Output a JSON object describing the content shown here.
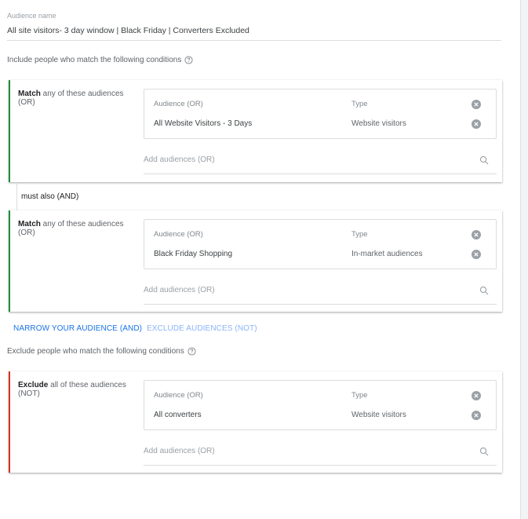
{
  "audience_name": {
    "label": "Audience name",
    "value": "All site visitors- 3 day window | Black Friday | Converters Excluded"
  },
  "include_heading": "Include people who match the following conditions",
  "exclude_heading": "Exclude people who match the following conditions",
  "connector_label": "must also (AND)",
  "groups": [
    {
      "match_word": "Match",
      "match_rest": " any of these audiences",
      "match_suffix": "(OR)",
      "audience_header": "Audience (OR)",
      "type_header": "Type",
      "audience_value": "All Website Visitors - 3 Days",
      "type_value": "Website visitors",
      "add_placeholder": "Add audiences (OR)"
    },
    {
      "match_word": "Match",
      "match_rest": " any of these audiences",
      "match_suffix": "(OR)",
      "audience_header": "Audience (OR)",
      "type_header": "Type",
      "audience_value": "Black Friday Shopping",
      "type_value": "In-market audiences",
      "add_placeholder": "Add audiences (OR)"
    }
  ],
  "exclude_group": {
    "match_word": "Exclude",
    "match_rest": " all of these audiences",
    "match_suffix": "(NOT)",
    "audience_header": "Audience (OR)",
    "type_header": "Type",
    "audience_value": "All converters",
    "type_value": "Website visitors",
    "add_placeholder": "Add audiences (OR)"
  },
  "actions": {
    "narrow": "NARROW YOUR AUDIENCE (AND)",
    "exclude": "EXCLUDE AUDIENCES (NOT)"
  },
  "colors": {
    "include_accent": "#1e8e3e",
    "exclude_accent": "#d93025",
    "link_primary": "#1a73e8",
    "link_secondary": "#8ab4f8"
  },
  "icons": {
    "help": "help-circle-icon",
    "remove": "remove-circle-icon",
    "search": "search-icon"
  }
}
